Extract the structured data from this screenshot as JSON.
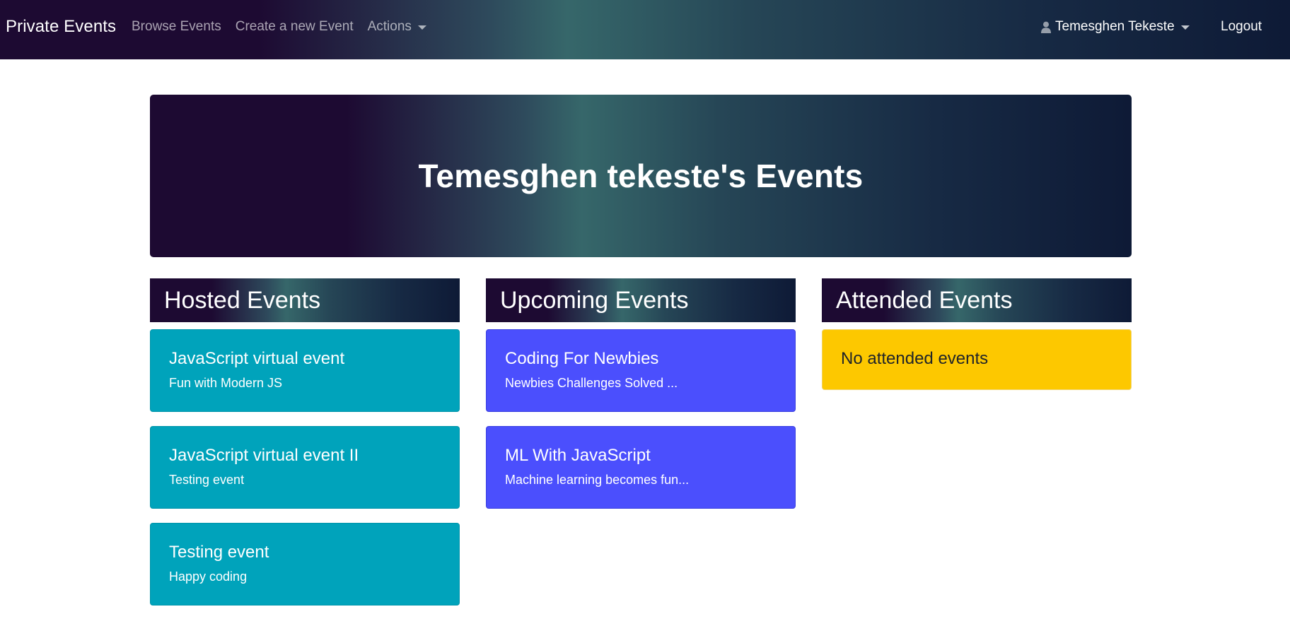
{
  "navbar": {
    "brand": "Private Events",
    "links": [
      "Browse Events",
      "Create a new Event"
    ],
    "actions_label": "Actions",
    "user_name": "Temesghen Tekeste",
    "logout_label": "Logout"
  },
  "jumbotron": {
    "title": "Temesghen tekeste's Events"
  },
  "hosted": {
    "heading": "Hosted Events",
    "events": [
      {
        "title": "JavaScript virtual event",
        "description": "Fun with Modern JS"
      },
      {
        "title": "JavaScript virtual event II",
        "description": "Testing event"
      },
      {
        "title": "Testing event",
        "description": "Happy coding"
      }
    ]
  },
  "upcoming": {
    "heading": "Upcoming Events",
    "events": [
      {
        "title": "Coding For Newbies",
        "description": "Newbies Challenges Solved ..."
      },
      {
        "title": "ML With JavaScript",
        "description": "Machine learning becomes fun..."
      }
    ]
  },
  "attended": {
    "heading": "Attended Events",
    "empty_message": "No attended events"
  },
  "colors": {
    "hosted_card": "#00a3bb",
    "upcoming_card": "#4b4ffd",
    "attended_empty": "#fdc800",
    "gradient_dark": "#1d0a32",
    "gradient_teal": "#36676a",
    "gradient_navy": "#0e1a36"
  },
  "icons": {
    "user": "user-icon",
    "dropdown": "chevron-down-icon"
  }
}
